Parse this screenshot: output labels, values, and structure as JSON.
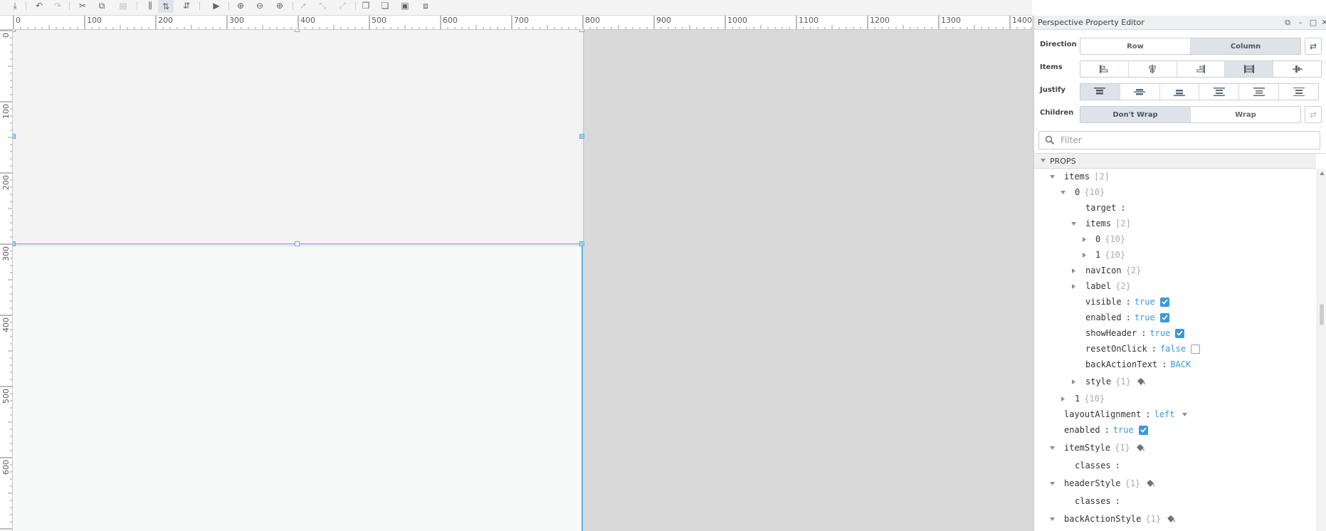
{
  "toolbar": {
    "buttons": [
      {
        "name": "save-icon",
        "glyph": "⤓"
      },
      {
        "name": "undo-icon",
        "glyph": "↶"
      },
      {
        "name": "redo-icon",
        "glyph": "↷"
      },
      {
        "name": "cut-icon",
        "glyph": "✂"
      },
      {
        "name": "copy-icon",
        "glyph": "⧉"
      },
      {
        "name": "paste-icon",
        "glyph": "▤"
      },
      {
        "name": "distribute-icon",
        "glyph": "⫼"
      },
      {
        "name": "align-vertical-icon",
        "glyph": "⇅"
      },
      {
        "name": "align-horizontal-icon",
        "glyph": "⇵"
      },
      {
        "name": "play-icon",
        "glyph": "▶"
      },
      {
        "name": "zoom-fit-icon",
        "glyph": "⊕"
      },
      {
        "name": "zoom-out-icon",
        "glyph": "⊖"
      },
      {
        "name": "zoom-in-icon",
        "glyph": "⊕"
      },
      {
        "name": "pointer-icon",
        "glyph": "➚"
      },
      {
        "name": "connector-icon",
        "glyph": "⤡"
      },
      {
        "name": "connector-alt-icon",
        "glyph": "⤢"
      },
      {
        "name": "bring-front-icon",
        "glyph": "❐"
      },
      {
        "name": "send-back-icon",
        "glyph": "❏"
      },
      {
        "name": "layer-icon",
        "glyph": "▣"
      },
      {
        "name": "group-icon",
        "glyph": "⧈"
      }
    ]
  },
  "ruler": {
    "top_labels": [
      "0",
      "100",
      "200",
      "300",
      "400",
      "500",
      "600",
      "700",
      "800",
      "900",
      "1000",
      "1100",
      "1200",
      "1300",
      "1400"
    ],
    "left_labels": [
      "0",
      "100",
      "200",
      "300",
      "400",
      "500",
      "600"
    ]
  },
  "property_editor": {
    "title": "Perspective Property Editor",
    "direction": {
      "label": "Direction",
      "options": [
        "Row",
        "Column"
      ],
      "selected": "Column"
    },
    "items": {
      "label": "Items"
    },
    "justify": {
      "label": "Justify"
    },
    "children": {
      "label": "Children",
      "options": [
        "Don't Wrap",
        "Wrap"
      ],
      "selected": "Don't Wrap"
    },
    "filter": {
      "placeholder": "Filter",
      "value": ""
    },
    "section_title": "PROPS",
    "tree": [
      {
        "key": "items",
        "meta": "[2]"
      },
      {
        "key": "0",
        "meta": "{10}"
      },
      {
        "key": "target",
        "colon": ":"
      },
      {
        "key": "items",
        "meta": "[2]"
      },
      {
        "key": "0",
        "meta": "{10}"
      },
      {
        "key": "1",
        "meta": "{10}"
      },
      {
        "key": "navIcon",
        "meta": "{2}"
      },
      {
        "key": "label",
        "meta": "{2}"
      },
      {
        "key": "visible",
        "colon": ":",
        "value": "true"
      },
      {
        "key": "enabled",
        "colon": ":",
        "value": "true"
      },
      {
        "key": "showHeader",
        "colon": ":",
        "value": "true"
      },
      {
        "key": "resetOnClick",
        "colon": ":",
        "value": "false"
      },
      {
        "key": "backActionText",
        "colon": ":",
        "value": "BACK"
      },
      {
        "key": "style",
        "meta": "{1}"
      },
      {
        "key": "1",
        "meta": "{10}"
      },
      {
        "key": "layoutAlignment",
        "colon": ":",
        "value": "left"
      },
      {
        "key": "enabled",
        "colon": ":",
        "value": "true"
      },
      {
        "key": "itemStyle",
        "meta": "{1}"
      },
      {
        "key": "classes",
        "colon": ":"
      },
      {
        "key": "headerStyle",
        "meta": "{1}"
      },
      {
        "key": "classes",
        "colon": ":"
      },
      {
        "key": "backActionStyle",
        "meta": "{1}"
      }
    ]
  },
  "colors": {
    "accent": "#3b99d6",
    "selection": "#5eb3e8",
    "canvas_bg": "#d9d9d9",
    "view_bg": "#f8f9f9",
    "container_bg": "#f3f3f3"
  }
}
